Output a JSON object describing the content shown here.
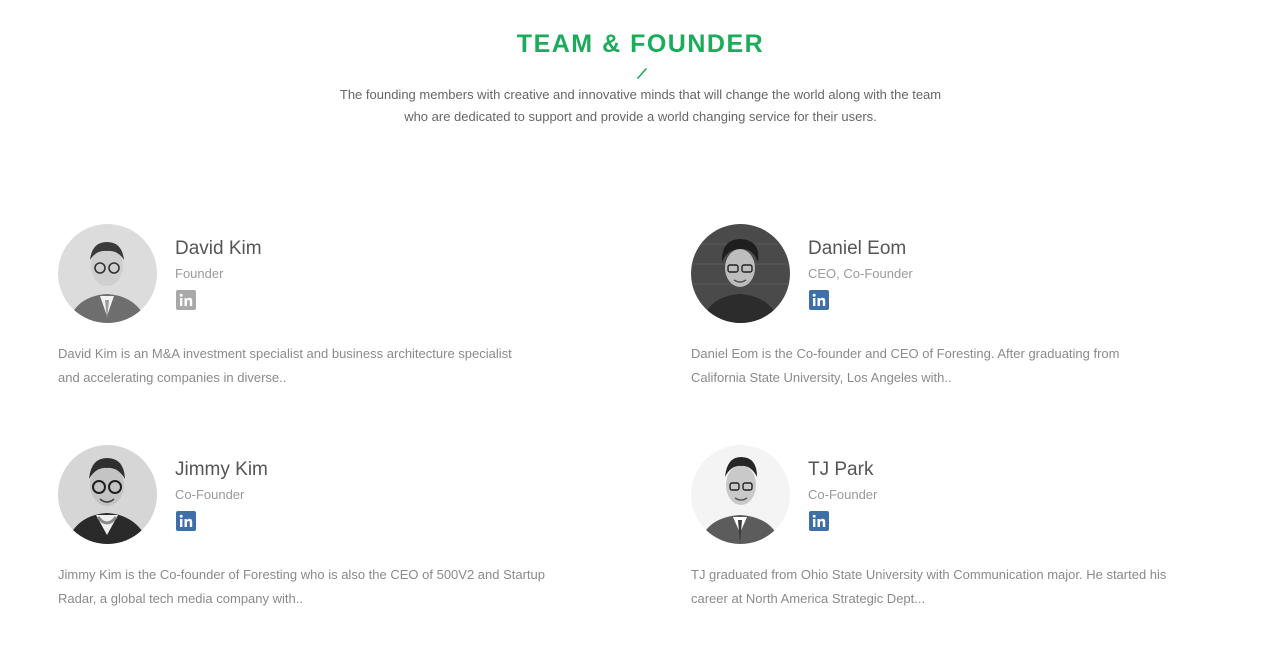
{
  "section": {
    "title": "TEAM & FOUNDER",
    "intro_line1": "The founding members with creative and innovative minds that will change the world along with the team",
    "intro_line2": "who are dedicated to support and provide a world changing service for their users.",
    "accent_color": "#1aac5a"
  },
  "members": [
    {
      "name": "David Kim",
      "role": "Founder",
      "social_icon": "linkedin-icon",
      "social_icon_color": "#a9a9a9",
      "bio_line1": "David Kim is an M&A investment specialist and business architecture specialist",
      "bio_line2": "and accelerating companies in diverse.."
    },
    {
      "name": "Daniel Eom",
      "role": "CEO, Co-Founder",
      "social_icon": "linkedin-icon",
      "social_icon_color": "#3f6fa8",
      "bio_line1": "Daniel Eom is the Co-founder and CEO of Foresting. After graduating from",
      "bio_line2": "California State University, Los Angeles with.."
    },
    {
      "name": "Jimmy Kim",
      "role": "Co-Founder",
      "social_icon": "linkedin-icon",
      "social_icon_color": "#3f6fa8",
      "bio_line1": "Jimmy Kim is the Co-founder of Foresting who is also the CEO of 500V2 and Startup",
      "bio_line2": "Radar, a global tech media company with.."
    },
    {
      "name": "TJ Park",
      "role": "Co-Founder",
      "social_icon": "linkedin-icon",
      "social_icon_color": "#3f6fa8",
      "bio_line1": "TJ graduated from Ohio State University with Communication major. He started his",
      "bio_line2": "career at North America Strategic Dept..."
    }
  ]
}
